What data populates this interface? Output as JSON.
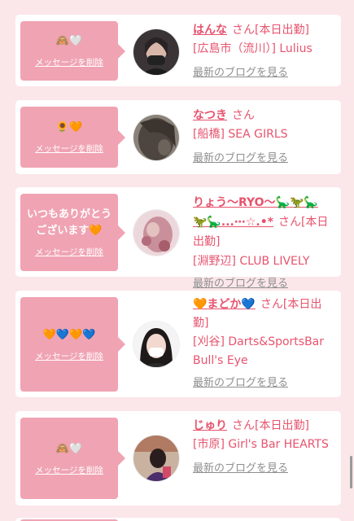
{
  "cards": [
    {
      "message": "🙈🤍",
      "delete_label": "メッセージを削除",
      "name": "はんな",
      "suffix": "さん[本日出勤]",
      "shop": "[広島市（流川）] Lulius",
      "blog_label": "最新のブログを見る"
    },
    {
      "message": "🌻🧡",
      "delete_label": "メッセージを削除",
      "name": "なつき",
      "suffix": "さん",
      "shop": "[船橋] SEA GIRLS",
      "blog_label": "最新のブログを見る"
    },
    {
      "message": "いつもありがとうございます🧡",
      "delete_label": "メッセージを削除",
      "name": "りょう〜RYO〜🦕🦖🦕 🦖🦕...⋯☆.•*",
      "suffix": "さん[本日出勤]",
      "shop": "[淵野辺] CLUB LIVELY",
      "blog_label": "最新のブログを見る"
    },
    {
      "message": "🧡💙🧡💙",
      "delete_label": "メッセージを削除",
      "name": "🧡まどか💙",
      "suffix": "さん[本日出勤]",
      "shop": "[刈谷] Darts&SportsBar Bull's Eye",
      "blog_label": "最新のブログを見る"
    },
    {
      "message": "🙈🤍",
      "delete_label": "メッセージを削除",
      "name": "じゅり",
      "suffix": "さん[本日出勤]",
      "shop": "[市原] Girl's Bar HEARTS",
      "blog_label": "最新のブログを見る"
    }
  ]
}
